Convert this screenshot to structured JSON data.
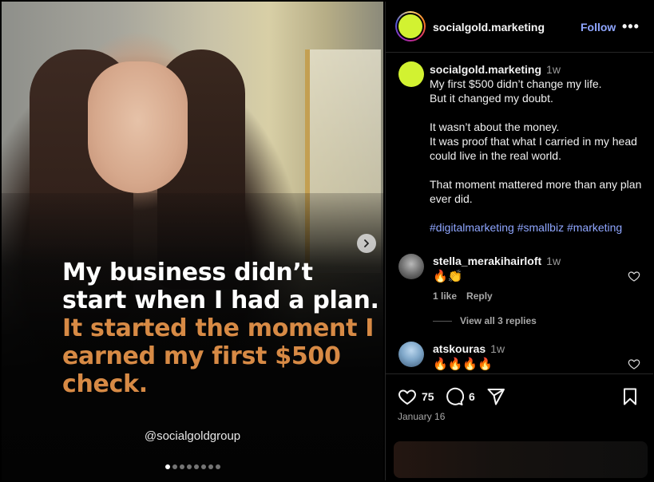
{
  "post": {
    "headline_white": "My business didn’t start when I had a plan.",
    "headline_orange": "It started the moment I earned my first $500 check.",
    "watermark": "@socialgoldgroup",
    "carousel": {
      "total": 8,
      "active_index": 0
    }
  },
  "header": {
    "username": "socialgold.marketing",
    "follow_label": "Follow",
    "more_label": "•••"
  },
  "caption": {
    "username": "socialgold.marketing",
    "time": "1w",
    "lines": [
      "My first $500 didn’t change my life.",
      "But it changed my doubt.",
      "",
      "It wasn’t about the money.",
      "It was proof that what I carried in my head could live in the real world.",
      "",
      "That moment mattered more than any plan ever did."
    ],
    "hashtags": "#digitalmarketing #smallbiz #marketing"
  },
  "comments": [
    {
      "username": "stella_merakihairloft",
      "time": "1w",
      "text": "🔥👏",
      "likes": "1 like",
      "reply_label": "Reply",
      "view_replies": "View all 3 replies"
    },
    {
      "username": "atskouras",
      "time": "1w",
      "text": "🔥🔥🔥🔥"
    }
  ],
  "actions": {
    "likes": "75",
    "comments": "6",
    "date": "January 16"
  },
  "colors": {
    "accent_blue": "#8fa6ff",
    "headline_orange": "#d78a45",
    "avatar_lime": "#d2f231"
  }
}
